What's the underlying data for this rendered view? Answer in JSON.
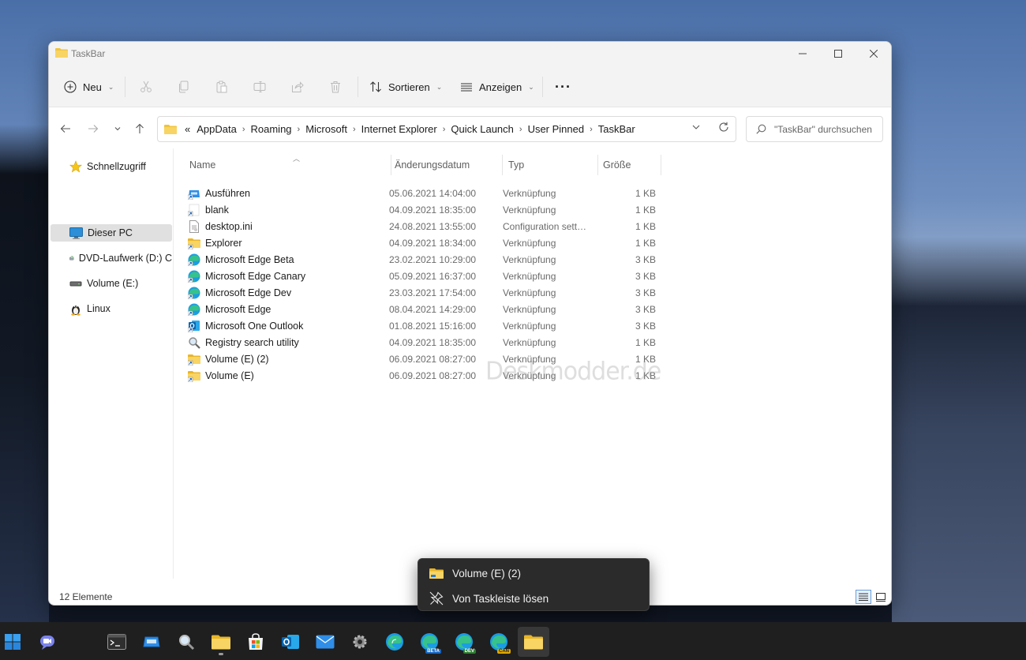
{
  "window": {
    "title": "TaskBar"
  },
  "toolbar": {
    "new_label": "Neu",
    "sort_label": "Sortieren",
    "view_label": "Anzeigen",
    "more_label": "···"
  },
  "address": {
    "overflow": "«",
    "crumbs": [
      "AppData",
      "Roaming",
      "Microsoft",
      "Internet Explorer",
      "Quick Launch",
      "User Pinned",
      "TaskBar"
    ],
    "search_placeholder": "\"TaskBar\" durchsuchen"
  },
  "nav": {
    "items": [
      {
        "label": "Schnellzugriff",
        "icon": "star-icon"
      },
      {
        "label": "Dieser PC",
        "icon": "computer-icon",
        "selected": true
      },
      {
        "label": "DVD-Laufwerk (D:) C",
        "icon": "dvd-icon"
      },
      {
        "label": "Volume (E:)",
        "icon": "drive-icon"
      },
      {
        "label": "Linux",
        "icon": "linux-icon"
      }
    ]
  },
  "columns": {
    "name": "Name",
    "date": "Änderungsdatum",
    "type": "Typ",
    "size": "Größe"
  },
  "files": [
    {
      "name": "Ausführen",
      "date": "05.06.2021 14:04:00",
      "type": "Verknüpfung",
      "size": "1 KB",
      "icon": "run-icon"
    },
    {
      "name": "blank",
      "date": "04.09.2021 18:35:00",
      "type": "Verknüpfung",
      "size": "1 KB",
      "icon": "shortcut-icon"
    },
    {
      "name": "desktop.ini",
      "date": "24.08.2021 13:55:00",
      "type": "Configuration sett…",
      "size": "1 KB",
      "icon": "ini-file-icon"
    },
    {
      "name": "Explorer",
      "date": "04.09.2021 18:34:00",
      "type": "Verknüpfung",
      "size": "1 KB",
      "icon": "folder-shortcut-icon"
    },
    {
      "name": "Microsoft Edge Beta",
      "date": "23.02.2021 10:29:00",
      "type": "Verknüpfung",
      "size": "3 KB",
      "icon": "edge-beta-icon"
    },
    {
      "name": "Microsoft Edge Canary",
      "date": "05.09.2021 16:37:00",
      "type": "Verknüpfung",
      "size": "3 KB",
      "icon": "edge-canary-icon"
    },
    {
      "name": "Microsoft Edge Dev",
      "date": "23.03.2021 17:54:00",
      "type": "Verknüpfung",
      "size": "3 KB",
      "icon": "edge-dev-icon"
    },
    {
      "name": "Microsoft Edge",
      "date": "08.04.2021 14:29:00",
      "type": "Verknüpfung",
      "size": "3 KB",
      "icon": "edge-icon"
    },
    {
      "name": "Microsoft One Outlook",
      "date": "01.08.2021 15:16:00",
      "type": "Verknüpfung",
      "size": "3 KB",
      "icon": "outlook-icon"
    },
    {
      "name": "Registry search utility",
      "date": "04.09.2021 18:35:00",
      "type": "Verknüpfung",
      "size": "1 KB",
      "icon": "registry-search-icon"
    },
    {
      "name": "Volume (E) (2)",
      "date": "06.09.2021 08:27:00",
      "type": "Verknüpfung",
      "size": "1 KB",
      "icon": "folder-shortcut-icon"
    },
    {
      "name": "Volume (E)",
      "date": "06.09.2021 08:27:00",
      "type": "Verknüpfung",
      "size": "1 KB",
      "icon": "folder-shortcut-icon"
    }
  ],
  "status": {
    "count": "12 Elemente"
  },
  "watermark": "Deskmodder.de",
  "jumplist": {
    "item1": "Volume (E) (2)",
    "item2": "Von Taskleiste lösen"
  },
  "taskbar": {
    "edge_beta_tag": "BETA",
    "edge_dev_tag": "DEV",
    "edge_canary_tag": "CAN"
  }
}
